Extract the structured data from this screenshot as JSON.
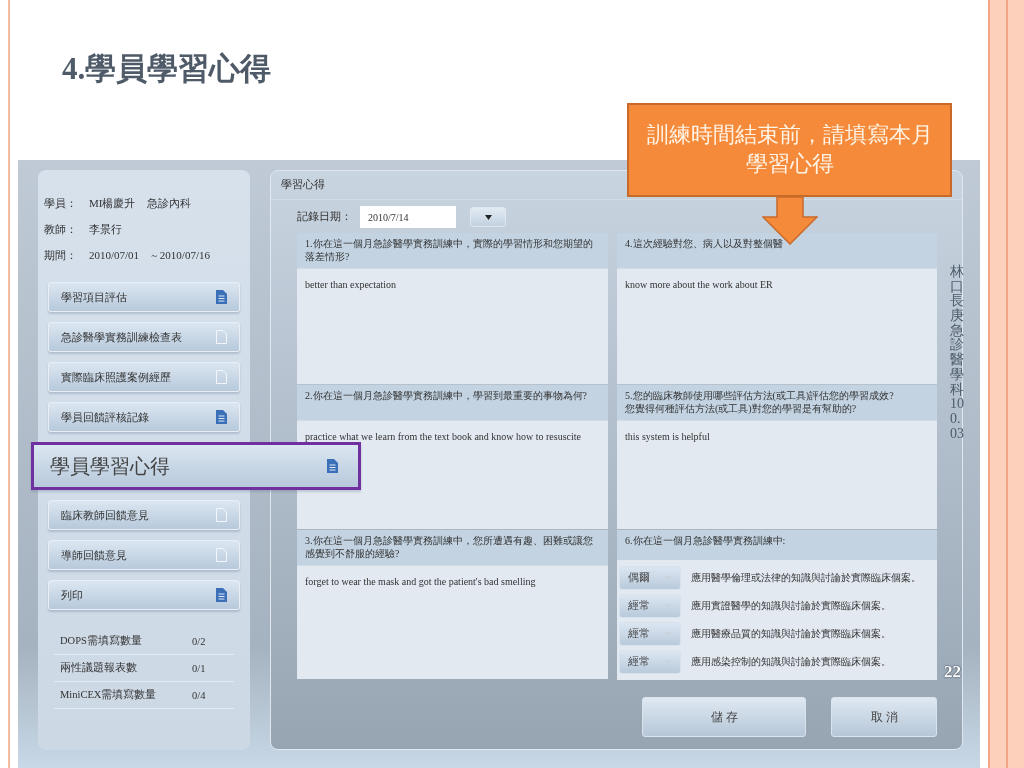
{
  "slide": {
    "title": "4.學員學習心得",
    "callout": "訓練時間結束前，請填寫本月學習心得",
    "page_number": "22",
    "side_label": "林口長庚急診醫學科100.03"
  },
  "info": [
    {
      "label": "學員：",
      "values": [
        "MI楊慶升",
        "急診內科"
      ]
    },
    {
      "label": "教師：",
      "values": [
        "李景行"
      ]
    },
    {
      "label": "期間：",
      "values": [
        "2010/07/01",
        "~ 2010/07/16"
      ]
    }
  ],
  "nav": [
    {
      "label": "學習項目評估",
      "filled": true,
      "highlighted": false
    },
    {
      "label": "急診醫學實務訓練檢查表",
      "filled": false,
      "highlighted": false
    },
    {
      "label": "實際臨床照護案例經歷",
      "filled": false,
      "highlighted": false
    },
    {
      "label": "學員回饋評核記錄",
      "filled": true,
      "highlighted": false
    },
    {
      "label": "學員學習心得",
      "filled": true,
      "highlighted": true
    },
    {
      "label": "臨床教師回饋意見",
      "filled": false,
      "highlighted": false
    },
    {
      "label": "導師回饋意見",
      "filled": false,
      "highlighted": false
    },
    {
      "label": "列印",
      "filled": true,
      "highlighted": false
    }
  ],
  "counts": [
    {
      "label": "DOPS需填寫數量",
      "value": "0/2"
    },
    {
      "label": "兩性議題報表數",
      "value": "0/1"
    },
    {
      "label": "MiniCEX需填寫數量",
      "value": "0/4"
    }
  ],
  "form": {
    "heading": "學習心得",
    "date_label": "記錄日期：",
    "date": "2010/7/14",
    "questions": [
      {
        "kind": "text",
        "question": "1.你在這一個月急診醫學實務訓練中，實際的學習情形和您期望的落差情形?",
        "answer": "better than expectation"
      },
      {
        "kind": "text",
        "question": "2.你在這一個月急診醫學實務訓練中，學習到最重要的事物為何?",
        "answer": "practice what we learn from the text book and know how to resuscite"
      },
      {
        "kind": "text",
        "question": "3.你在這一個月急診醫學實務訓練中，您所遭遇有趣、困難或讓您感覺到不舒服的經驗?",
        "answer": "forget to wear the mask and got the patient's bad smelling"
      },
      {
        "kind": "text",
        "question": "4.這次經驗對您、病人以及對整個醫",
        "answer": "know more about the work about ER"
      },
      {
        "kind": "text",
        "question": "5.您的臨床教師使用哪些評估方法(或工具)評估您的學習成效?\n您覺得何種評估方法(或工具)對您的學習是有幫助的?",
        "answer": "this system is helpful"
      },
      {
        "kind": "rating",
        "question": "6.你在這一個月急診醫學實務訓練中:",
        "rows": [
          {
            "value": "偶爾",
            "text": "應用醫學倫理或法律的知識與討論於實際臨床個案。"
          },
          {
            "value": "經常",
            "text": "應用實證醫學的知識與討論於實際臨床個案。"
          },
          {
            "value": "經常",
            "text": "應用醫療品質的知識與討論於實際臨床個案。"
          },
          {
            "value": "經常",
            "text": "應用感染控制的知識與討論於實際臨床個案。"
          }
        ]
      }
    ],
    "buttons": [
      "儲 存",
      "取 消"
    ]
  }
}
